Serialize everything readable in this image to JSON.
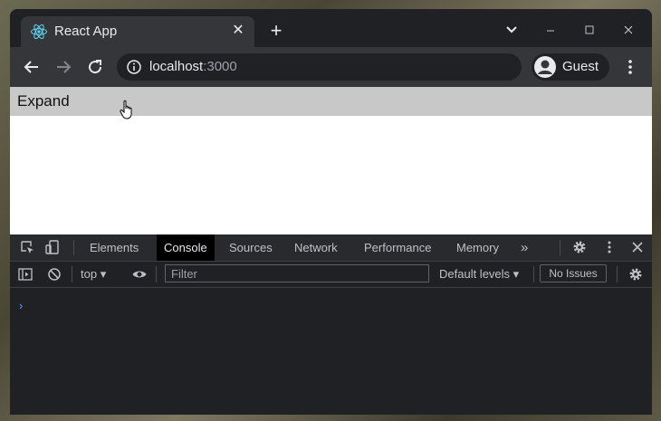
{
  "browser": {
    "tab_title": "React App",
    "url_host": "localhost",
    "url_port": ":3000",
    "profile_name": "Guest"
  },
  "page": {
    "expand_label": "Expand"
  },
  "devtools": {
    "tabs": [
      "Elements",
      "Console",
      "Sources",
      "Network",
      "Performance",
      "Memory"
    ],
    "active_tab": "Console",
    "more_label": "»",
    "context": "top",
    "filter_placeholder": "Filter",
    "levels_label": "Default levels",
    "issues_label": "No Issues",
    "prompt_symbol": "›"
  },
  "colors": {
    "frame": "#202124",
    "toolbar": "#35363a",
    "expand_bar": "#c8c8c8",
    "accent_blue": "#4fa3ff"
  }
}
